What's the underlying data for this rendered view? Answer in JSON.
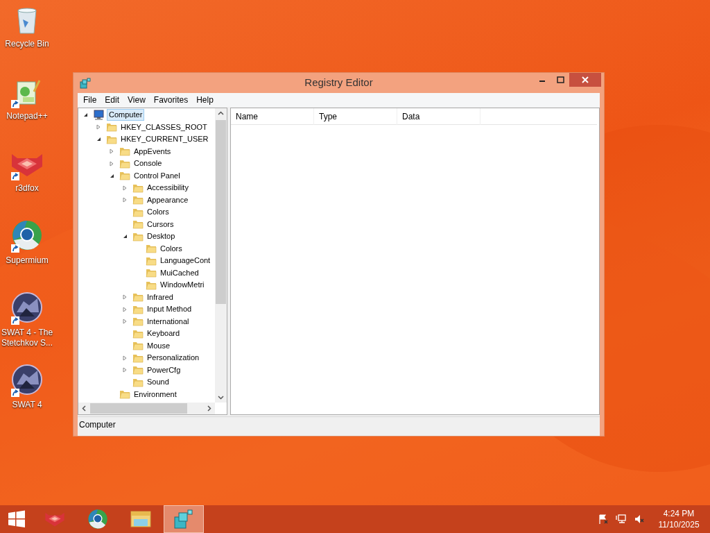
{
  "desktop_icons": [
    {
      "label": "Recycle Bin",
      "shortcut": false
    },
    {
      "label": "Notepad++",
      "shortcut": true
    },
    {
      "label": "r3dfox",
      "shortcut": true
    },
    {
      "label": "Supermium",
      "shortcut": true
    },
    {
      "label": "SWAT 4 - The Stetchkov S...",
      "shortcut": true
    },
    {
      "label": "SWAT 4",
      "shortcut": true
    }
  ],
  "window": {
    "title": "Registry Editor"
  },
  "menu": [
    "File",
    "Edit",
    "View",
    "Favorites",
    "Help"
  ],
  "tree": [
    {
      "label": "Computer",
      "selected": true,
      "expanded": true,
      "children": [
        {
          "label": "HKEY_CLASSES_ROOT",
          "selected": false,
          "expanded": false
        },
        {
          "label": "HKEY_CURRENT_USER",
          "selected": false,
          "expanded": true,
          "children": [
            {
              "label": "AppEvents",
              "selected": false,
              "expanded": false
            },
            {
              "label": "Console",
              "selected": false,
              "expanded": false
            },
            {
              "label": "Control Panel",
              "selected": false,
              "expanded": true,
              "children": [
                {
                  "label": "Accessibility",
                  "selected": false,
                  "expanded": false
                },
                {
                  "label": "Appearance",
                  "selected": false,
                  "expanded": false
                },
                {
                  "label": "Colors",
                  "selected": false
                },
                {
                  "label": "Cursors",
                  "selected": false
                },
                {
                  "label": "Desktop",
                  "selected": false,
                  "expanded": true,
                  "children": [
                    {
                      "label": "Colors",
                      "selected": false
                    },
                    {
                      "label": "LanguageCont",
                      "selected": false
                    },
                    {
                      "label": "MuiCached",
                      "selected": false
                    },
                    {
                      "label": "WindowMetri",
                      "selected": false
                    }
                  ]
                },
                {
                  "label": "Infrared",
                  "selected": false,
                  "expanded": false
                },
                {
                  "label": "Input Method",
                  "selected": false,
                  "expanded": false
                },
                {
                  "label": "International",
                  "selected": false,
                  "expanded": false
                },
                {
                  "label": "Keyboard",
                  "selected": false
                },
                {
                  "label": "Mouse",
                  "selected": false
                },
                {
                  "label": "Personalization",
                  "selected": false,
                  "expanded": false
                },
                {
                  "label": "PowerCfg",
                  "selected": false,
                  "expanded": false
                },
                {
                  "label": "Sound",
                  "selected": false
                }
              ]
            },
            {
              "label": "Environment",
              "selected": false
            }
          ]
        }
      ]
    }
  ],
  "columns": [
    "Name",
    "Type",
    "Data"
  ],
  "status_bar": "Computer",
  "taskbar": {
    "items": [
      {
        "selected": false
      },
      {
        "selected": false
      },
      {
        "selected": false
      },
      {
        "selected": true
      }
    ],
    "clock": {
      "time": "4:24 PM",
      "date": "11/10/2025"
    }
  }
}
